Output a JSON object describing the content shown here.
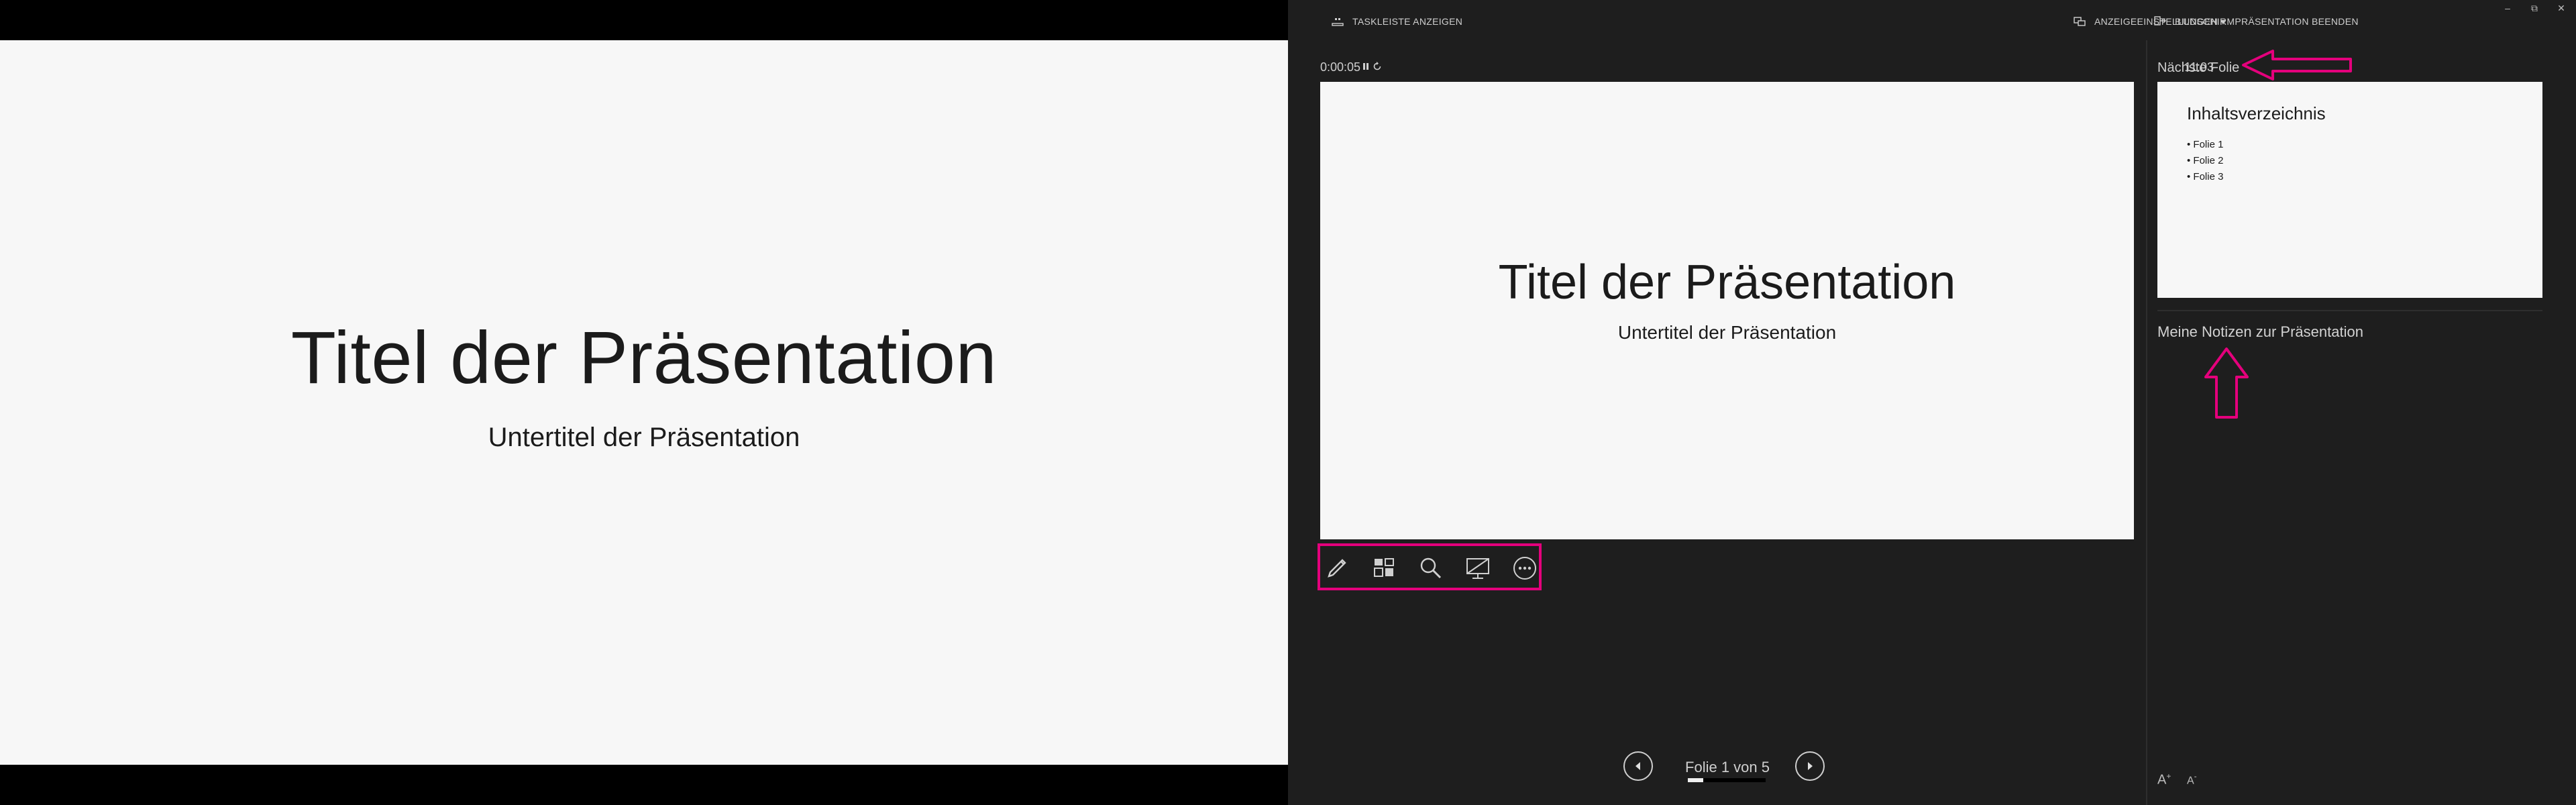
{
  "audience_slide": {
    "title": "Titel der Präsentation",
    "subtitle": "Untertitel der Präsentation"
  },
  "topbar": {
    "taskbar_label": "TASKLEISTE ANZEIGEN",
    "display_settings_label": "ANZEIGEEINSTELLUNGEN ▾",
    "end_show_label": "BILDSCHIRMPRÄSENTATION BEENDEN",
    "window_controls": [
      "–",
      "⧉",
      "✕"
    ]
  },
  "timer": {
    "elapsed": "0:00:05",
    "clock": "11:03"
  },
  "current_slide": {
    "title": "Titel der Präsentation",
    "subtitle": "Untertitel der Präsentation"
  },
  "tools": [
    "pen-icon",
    "see-all-slides-icon",
    "zoom-icon",
    "black-screen-icon",
    "more-options-icon"
  ],
  "navigation": {
    "label": "Folie 1 von 5",
    "current": 1,
    "total": 5
  },
  "next_slide": {
    "label": "Nächste Folie",
    "title": "Inhaltsverzeichnis",
    "bullets": [
      "Folie 1",
      "Folie 2",
      "Folie 3"
    ]
  },
  "notes": {
    "text": "Meine Notizen zur Präsentation"
  },
  "font_controls": {
    "increase": "A",
    "decrease": "A"
  },
  "colors": {
    "presenter_bg": "#1e1e1e",
    "slide_bg": "#f7f7f7",
    "highlight": "#e4007c"
  }
}
